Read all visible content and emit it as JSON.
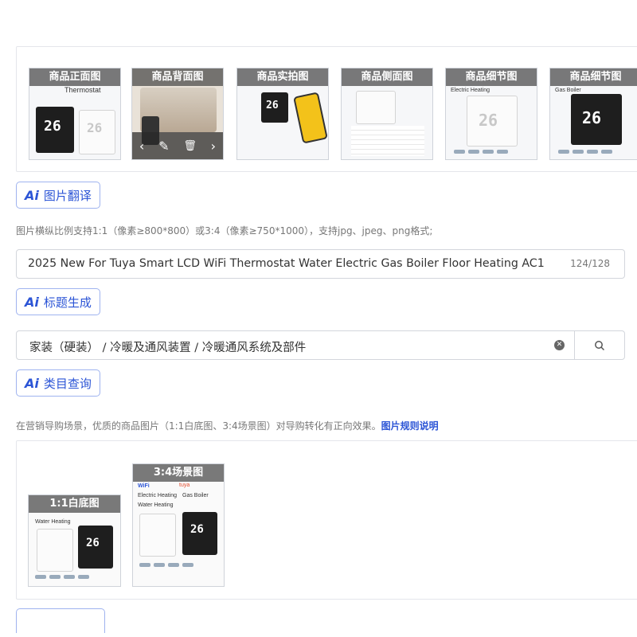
{
  "gallery": {
    "thumbnails": [
      {
        "caption": "商品正面图",
        "overlay_text": "Thermostat"
      },
      {
        "caption": "商品背面图"
      },
      {
        "caption": "商品实拍图"
      },
      {
        "caption": "商品侧面图"
      },
      {
        "caption": "商品细节图",
        "overlay_text": "Electric Heating"
      },
      {
        "caption": "商品细节图",
        "overlay_text": "Gas Boiler"
      }
    ],
    "hover_tools": {
      "prev": "‹",
      "edit": "✎",
      "delete": "🗑",
      "next": "›"
    }
  },
  "image_translate": {
    "ai": "Ai",
    "label": "图片翻译"
  },
  "image_hint": "图片横纵比例支持1:1（像素≥800*800）或3:4（像素≥750*1000），支持jpg、jpeg、png格式;",
  "title_field": {
    "value": "2025 New For Tuya Smart LCD WiFi Thermostat Water Electric Gas Boiler Floor Heating AC1",
    "counter": "124/128"
  },
  "title_generate": {
    "ai": "Ai",
    "label": "标题生成"
  },
  "category_field": {
    "value": "家装（硬装） / 冷暖及通风装置 / 冷暖通风系统及部件",
    "clear_icon": "clear-icon",
    "search_icon": "search-icon"
  },
  "category_query": {
    "ai": "Ai",
    "label": "类目查询"
  },
  "marketing_hint": {
    "text": "在营销导购场景，优质的商品图片（1:1白底图、3:4场景图）对导购转化有正向效果。",
    "link": "图片规则说明"
  },
  "marketing_images": [
    {
      "caption": "1:1白底图",
      "texts": [
        "Water Heating"
      ]
    },
    {
      "caption": "3:4场景图",
      "texts": [
        "Electric Heating",
        "Water Heating",
        "Gas Boiler",
        "WiFi",
        "tuya"
      ]
    }
  ],
  "digits": "26",
  "colors": {
    "accent": "#2c55d6",
    "border": "#d3d6dc",
    "link": "#2c55d6"
  }
}
